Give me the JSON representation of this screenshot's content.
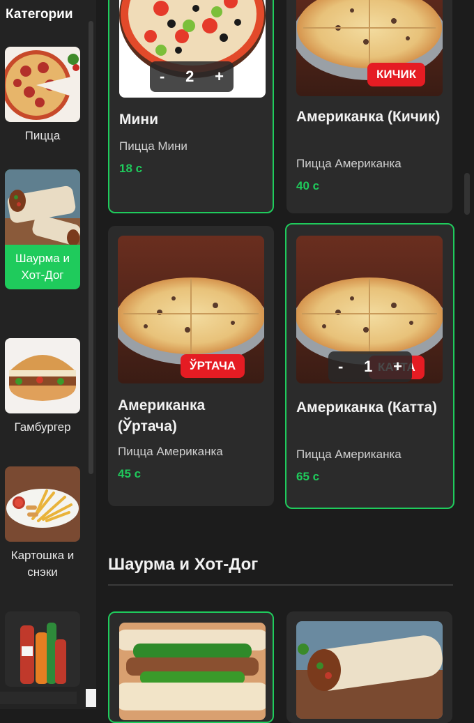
{
  "sidebar": {
    "title": "Категории",
    "categories": [
      {
        "label": "Пицца",
        "icon": "pizza-image"
      },
      {
        "label": "Шаурма и Хот-Дог",
        "icon": "shawarma-image",
        "active": true
      },
      {
        "label": "Гамбургер",
        "icon": "burger-image"
      },
      {
        "label": "Картошка и снэки",
        "icon": "fries-image"
      },
      {
        "label": "",
        "icon": "drinks-image"
      }
    ]
  },
  "products": [
    {
      "name": "Мини",
      "subtitle": "Пицца Мини",
      "price": "18 с",
      "quantity": "2",
      "selected": true
    },
    {
      "name": "Американка (Кичик)",
      "subtitle": "Пицца Американка",
      "price": "40 с",
      "badge": "КИЧИК"
    },
    {
      "name": "Американка (Ўртача)",
      "subtitle": "Пицца Американка",
      "price": "45 с",
      "badge": "ЎРТАЧА"
    },
    {
      "name": "Американка (Катта)",
      "subtitle": "Пицца Американка",
      "price": "65 с",
      "badge": "КАТТА",
      "quantity": "1",
      "selected": true
    }
  ],
  "stepper": {
    "minus": "-",
    "plus": "+"
  },
  "section": {
    "title": "Шаурма и Хот-Дог"
  },
  "colors": {
    "accent": "#1fcb5c",
    "badge": "#e51c23",
    "background": "#1c1c1c",
    "card": "#2b2b2b"
  }
}
